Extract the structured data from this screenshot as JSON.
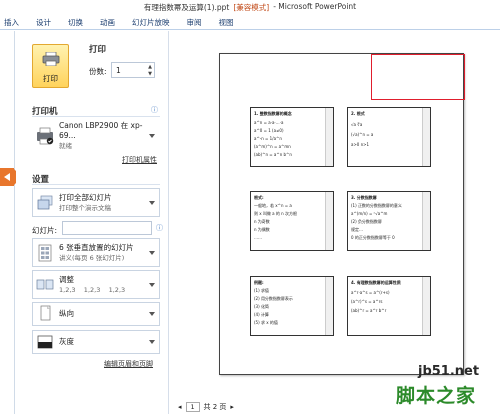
{
  "window": {
    "title_prefix": "有理指数幂及运算(1).ppt",
    "title_mode": "[兼容模式]",
    "title_app": "- Microsoft PowerPoint"
  },
  "ribbon": {
    "tabs": [
      "插入",
      "设计",
      "切换",
      "动画",
      "幻灯片放映",
      "审阅",
      "视图"
    ]
  },
  "print": {
    "section_label": "打印",
    "button_label": "打印",
    "copies_label": "份数:",
    "copies_value": "1"
  },
  "printer": {
    "section_label": "打印机",
    "name": "Canon LBP2900 在 xp-69...",
    "status": "就绪",
    "properties_link": "打印机属性"
  },
  "settings": {
    "section_label": "设置",
    "range_main": "打印全部幻灯片",
    "range_sub": "打印整个演示文稿",
    "slides_label": "幻灯片:",
    "slides_value": "",
    "layout_main": "6 张垂直放置的幻灯片",
    "layout_sub": "讲义(每页 6 张幻灯片)",
    "collate_main": "调整",
    "collate_sub": "1,2,3    1,2,3    1,2,3",
    "orientation_main": "纵向",
    "color_main": "灰度",
    "edit_header_link": "编辑页眉和页脚"
  },
  "preview": {
    "page_number": "1",
    "page_total": "共 2 页"
  },
  "thumbnails": [
    {
      "lines": [
        "1. 整数指数幂的概念",
        "a^n = a·a·…·a",
        "a^0 = 1 (a≠0)",
        "a^-n = 1/a^n",
        "(a^m)^n = a^mn",
        "(ab)^n = a^n b^n"
      ]
    },
    {
      "lines": [
        "2. 根式",
        "√a  ∛a",
        "(√a)^n = a",
        "a>0  n>1"
      ]
    },
    {
      "lines": [
        "根式:",
        "一般地，若 x^n = a",
        "则 x 叫做 a 的 n 次方根",
        "n 为奇数",
        "n 为偶数",
        "……"
      ]
    },
    {
      "lines": [
        "3. 分数指数幂",
        "(1) 正数的分数指数幂的意义",
        "a^(m/n) = ⁿ√a^m",
        "(2) 负分数指数幂",
        "规定…",
        "0 的正分数指数幂等于 0"
      ]
    },
    {
      "lines": [
        "例题:",
        "(1) 求值",
        "(2) 用分数指数幂表示",
        "(3) 化简",
        "(4) 计算",
        "(5) 求 x 的值"
      ]
    },
    {
      "lines": [
        "4. 有理数指数幂的运算性质",
        "a^r·a^s = a^(r+s)",
        "(a^r)^s = a^rs",
        "(ab)^r = a^r b^r"
      ]
    }
  ],
  "watermark": {
    "site": "jb51.net",
    "text": "脚本之家"
  },
  "colors": {
    "accent_orange": "#e8762c",
    "highlight_red": "#e01e2d",
    "watermark_green": "#2c8a2a"
  }
}
